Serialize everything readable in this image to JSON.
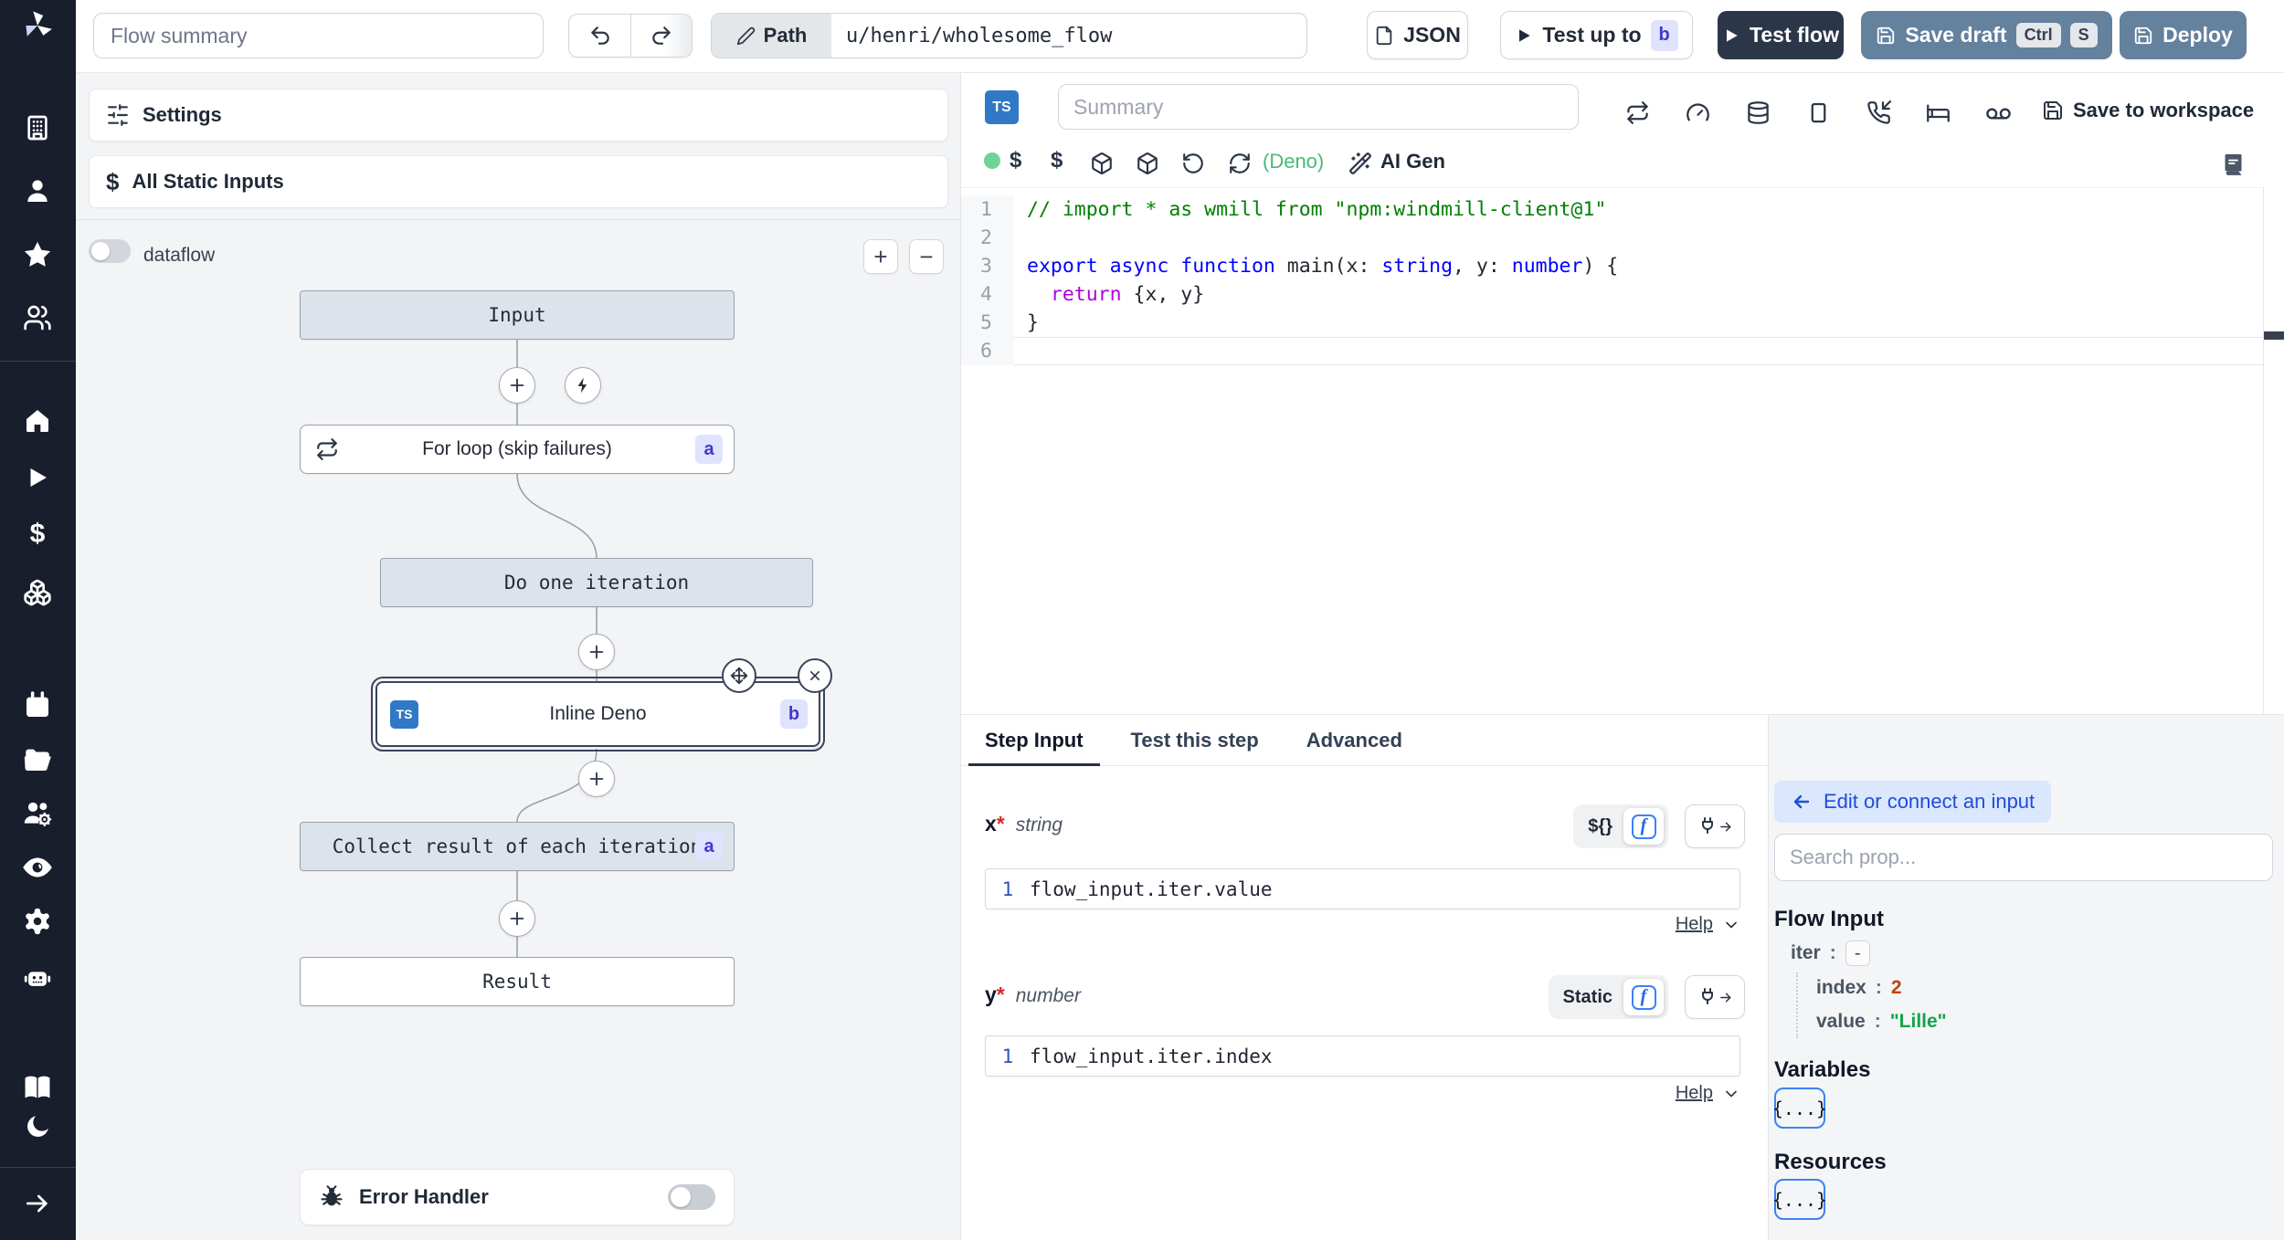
{
  "topbar": {
    "flow_summary_placeholder": "Flow summary",
    "path_label": "Path",
    "path_value": "u/henri/wholesome_flow",
    "json_button": "JSON",
    "test_up_to": "Test up to",
    "test_up_to_badge": "b",
    "test_flow": "Test flow",
    "save_draft": "Save draft",
    "kbd_ctrl": "Ctrl",
    "kbd_s": "S",
    "deploy": "Deploy"
  },
  "flow_panel": {
    "settings": "Settings",
    "all_static_inputs": "All Static Inputs",
    "dataflow": "dataflow",
    "zoom_in": "+",
    "zoom_out": "−",
    "error_handler": "Error Handler",
    "graph": {
      "input": "Input",
      "for_loop": "For loop (skip failures)",
      "for_loop_badge": "a",
      "iteration": "Do one iteration",
      "inline_step": "Inline Deno",
      "inline_badge": "b",
      "inline_lang": "TS",
      "collect": "Collect result of each iteration",
      "collect_badge": "a",
      "result": "Result"
    }
  },
  "editor": {
    "lang_badge": "TS",
    "summary_placeholder": "Summary",
    "save_to_workspace": "Save to workspace",
    "runtime": "(Deno)",
    "ai_gen": "AI Gen",
    "code": [
      {
        "n": "1",
        "segs": [
          {
            "t": "// import * as wmill from \"npm:windmill-client@1\"",
            "c": "cmt"
          }
        ]
      },
      {
        "n": "2",
        "segs": []
      },
      {
        "n": "3",
        "segs": [
          {
            "t": "export async function ",
            "c": "kw"
          },
          {
            "t": "main",
            "c": "fn"
          },
          {
            "t": "(x: ",
            "c": "pl"
          },
          {
            "t": "string",
            "c": "kw"
          },
          {
            "t": ", y: ",
            "c": "pl"
          },
          {
            "t": "number",
            "c": "kw"
          },
          {
            "t": ") {",
            "c": "pl"
          }
        ]
      },
      {
        "n": "4",
        "segs": [
          {
            "t": "  ",
            "c": "pl"
          },
          {
            "t": "return",
            "c": "ctrl"
          },
          {
            "t": " {x, y}",
            "c": "pl"
          }
        ]
      },
      {
        "n": "5",
        "segs": [
          {
            "t": "}",
            "c": "pl"
          }
        ]
      },
      {
        "n": "6",
        "segs": []
      }
    ]
  },
  "step_panel": {
    "tabs": [
      "Step Input",
      "Test this step",
      "Advanced"
    ],
    "fn_glyph": "f",
    "fields": [
      {
        "name": "x",
        "req": "*",
        "type": "string",
        "mode": "${}",
        "line": "1",
        "expr": "flow_input.iter.value",
        "help": "Help"
      },
      {
        "name": "y",
        "req": "*",
        "type": "number",
        "mode": "Static",
        "line": "1",
        "expr": "flow_input.iter.index",
        "help": "Help"
      }
    ]
  },
  "props_panel": {
    "connect_button": "Edit or connect an input",
    "search_placeholder": "Search prop...",
    "flow_input_title": "Flow Input",
    "tree": {
      "sep": ":",
      "iter_key": "iter",
      "iter_toggle": "-",
      "index_key": "index",
      "index_value": "2",
      "value_key": "value",
      "value_value": "\"Lille\""
    },
    "variables_title": "Variables",
    "resources_title": "Resources",
    "object_chip": "{...}"
  },
  "colors": {
    "sidebar": "#181e2c",
    "accent_steel": "#64819e",
    "dark_navy": "#2b3648",
    "badge_bg": "#dfe3fd",
    "badge_text": "#4338ca",
    "ts_blue": "#3178c6",
    "string_green": "#16a34a",
    "number_orange": "#c2410c",
    "link_blue": "#1d4ed8",
    "runtime_green": "#48ba75"
  }
}
